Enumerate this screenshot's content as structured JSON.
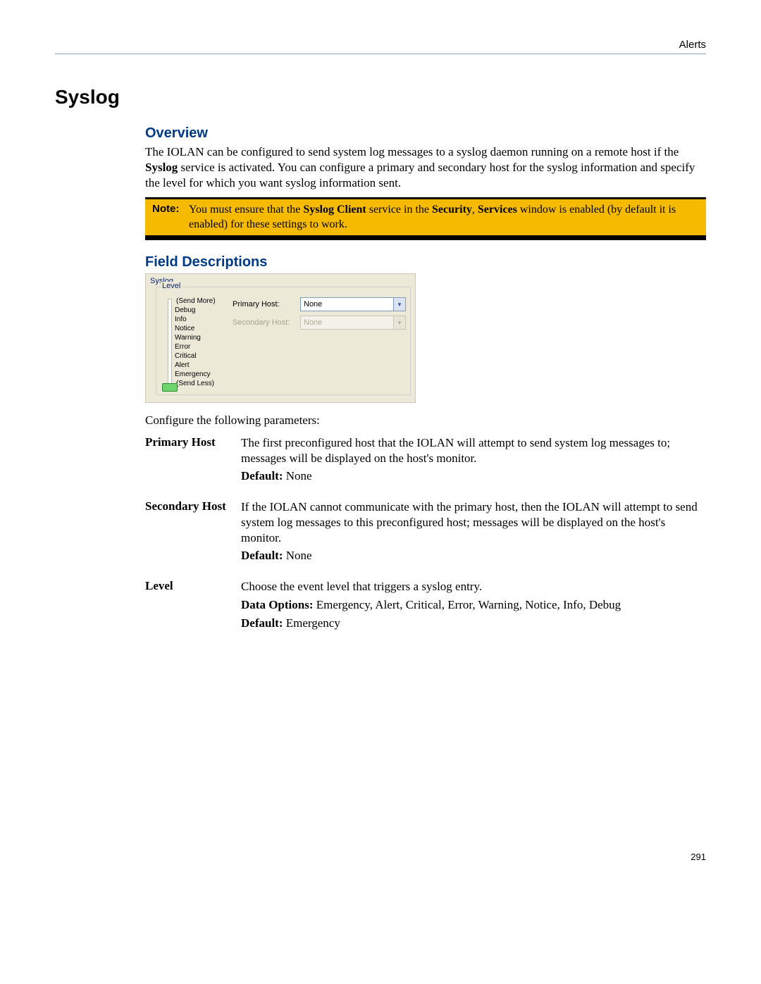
{
  "header": {
    "breadcrumb": "Alerts"
  },
  "section": {
    "title": "Syslog",
    "overview_heading": "Overview",
    "overview_p1a": "The IOLAN can be configured to send system log messages to a syslog daemon running on a remote host if the ",
    "overview_bold1": "Syslog",
    "overview_p1b": " service is activated. You can configure a primary and secondary host for the syslog information and specify the level for which you want syslog information sent.",
    "field_desc_heading": "Field Descriptions",
    "config_intro": "Configure the following parameters:"
  },
  "note": {
    "label": "Note:",
    "t1": "You must ensure that the ",
    "b1": "Syslog Client",
    "t2": " service in the ",
    "b2": "Security",
    "t3": ", ",
    "b3": "Services",
    "t4": " window is enabled (by default it is enabled) for these settings to work."
  },
  "panel": {
    "group_outer": "Syslog",
    "group_inner": "Level",
    "send_more": "(Send More)",
    "send_less": "(Send Less)",
    "levels": [
      "Debug",
      "Info",
      "Notice",
      "Warning",
      "Error",
      "Critical",
      "Alert",
      "Emergency"
    ],
    "primary_label": "Primary Host:",
    "primary_value": "None",
    "secondary_label": "Secondary Host:",
    "secondary_value": "None"
  },
  "params": [
    {
      "term": "Primary Host",
      "desc": "The first preconfigured host that the IOLAN will attempt to send system log messages to; messages will be displayed on the host's monitor.",
      "default_label": "Default:",
      "default_value": " None"
    },
    {
      "term": "Secondary Host",
      "desc": "If the IOLAN cannot communicate with the primary host, then the IOLAN will attempt to send system log messages to this preconfigured host; messages will be displayed on the host's monitor.",
      "default_label": "Default:",
      "default_value": " None"
    },
    {
      "term": "Level",
      "desc": "Choose the event level that triggers a syslog entry.",
      "options_label": "Data Options:",
      "options_value": " Emergency, Alert, Critical, Error, Warning, Notice, Info, Debug",
      "default_label": "Default:",
      "default_value": " Emergency"
    }
  ],
  "page_number": "291"
}
